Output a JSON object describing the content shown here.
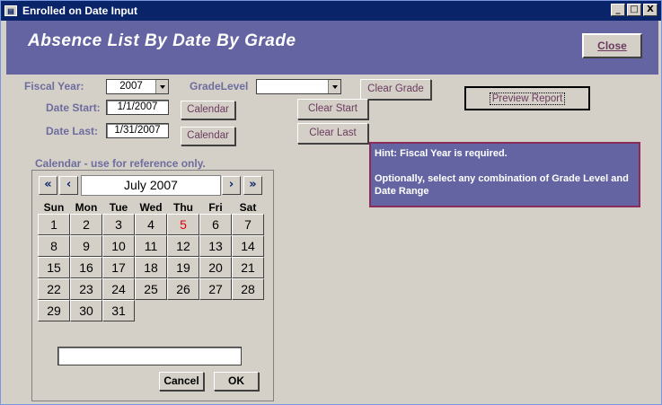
{
  "window": {
    "title": "Enrolled on Date Input",
    "controls": {
      "minimize": "_",
      "maximize": "□",
      "close": "X"
    }
  },
  "header": {
    "title": "Absence List By Date By Grade",
    "close_label": "Close"
  },
  "form": {
    "fiscal_year_label": "Fiscal Year:",
    "fiscal_year_value": "2007",
    "grade_level_label": "GradeLevel",
    "grade_level_value": "",
    "date_start_label": "Date Start:",
    "date_start_value": "1/1/2007",
    "date_last_label": "Date Last:",
    "date_last_value": "1/31/2007",
    "calendar_btn_label": "Calendar",
    "clear_grade_label": "Clear Grade",
    "clear_start_label": "Clear Start",
    "clear_last_label": "Clear Last",
    "preview_label": "Preview  Report"
  },
  "hint": {
    "line1": "Hint:   Fiscal Year is required.",
    "line2": "Optionally, select any combination of Grade Level and Date Range"
  },
  "calendar": {
    "label": "Calendar - use for reference only.",
    "month_title": "July 2007",
    "nav": {
      "prev_year": "«",
      "prev_month": "‹",
      "next_month": "›",
      "next_year": "»"
    },
    "weekdays": [
      "Sun",
      "Mon",
      "Tue",
      "Wed",
      "Thu",
      "Fri",
      "Sat"
    ],
    "days": [
      "1",
      "2",
      "3",
      "4",
      "5",
      "6",
      "7",
      "8",
      "9",
      "10",
      "11",
      "12",
      "13",
      "14",
      "15",
      "16",
      "17",
      "18",
      "19",
      "20",
      "21",
      "22",
      "23",
      "24",
      "25",
      "26",
      "27",
      "28",
      "29",
      "30",
      "31"
    ],
    "highlighted_day": "5",
    "highlight_color": "#e00000",
    "input_value": "",
    "cancel_label": "Cancel",
    "ok_label": "OK"
  },
  "colors": {
    "header_bg": "#6464a3",
    "hint_border": "#8a2d5c",
    "label_color": "#6d6d9e",
    "button_text": "#6b3a5e"
  }
}
